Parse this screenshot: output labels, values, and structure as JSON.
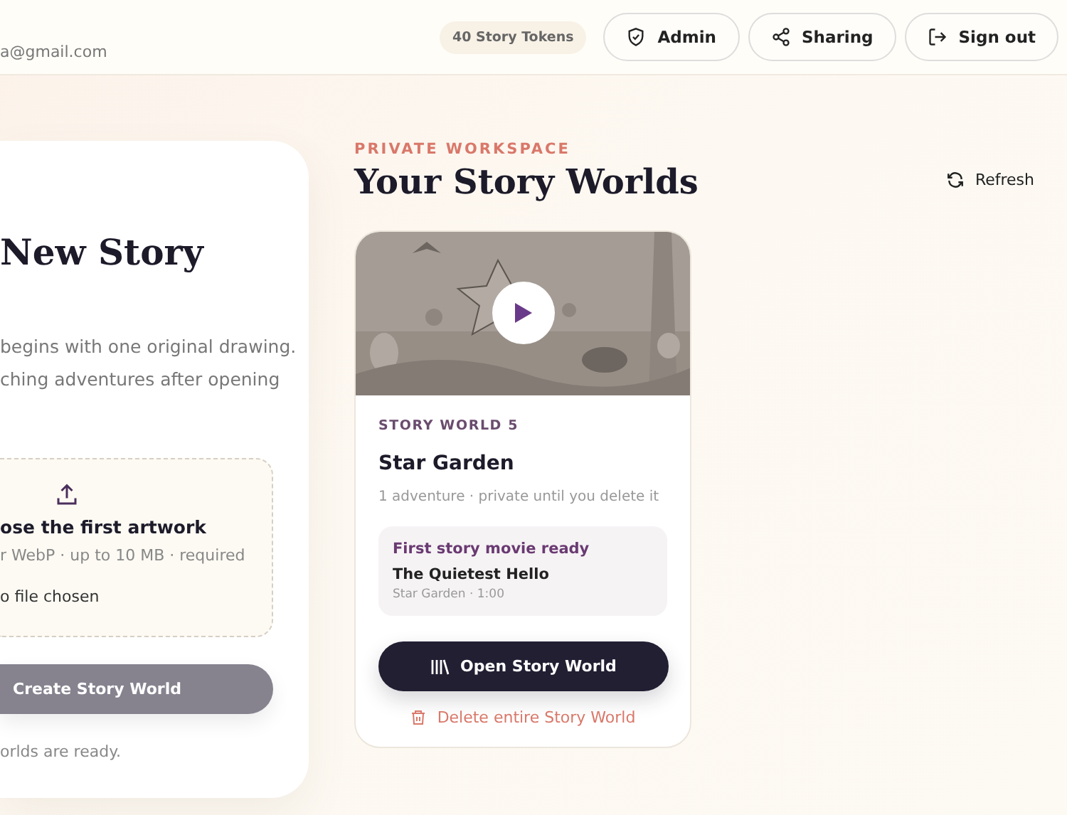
{
  "header": {
    "email": "a@gmail.com",
    "tokens": "40 Story Tokens",
    "buttons": [
      {
        "kind": "admin",
        "label": "Admin"
      },
      {
        "kind": "sharing",
        "label": "Sharing"
      },
      {
        "kind": "signout",
        "label": "Sign out"
      }
    ]
  },
  "new_story": {
    "title": "New Story",
    "description": [
      "begins with one original drawing.",
      "ching adventures after opening"
    ],
    "upload": {
      "title": "ose the first artwork",
      "hint": "r WebP · up to 10 MB · required",
      "file": "o file chosen"
    },
    "create_button": {
      "label": "Create Story World",
      "disabled": true
    },
    "note": "orlds are ready."
  },
  "workspace": {
    "eyebrow": "PRIVATE WORKSPACE",
    "title": "Your Story Worlds",
    "refresh": "Refresh",
    "worlds": [
      {
        "kind": "picture",
        "number": "STORY WORLD 5",
        "name": "Star Garden",
        "meta": "1 adventure · private until you delete it",
        "movie": {
          "status": "First story movie ready",
          "title": "The Quietest Hello",
          "details": "Star Garden · 1:00"
        },
        "open": "Open Story World",
        "delete": "Delete entire Story World"
      }
    ]
  }
}
